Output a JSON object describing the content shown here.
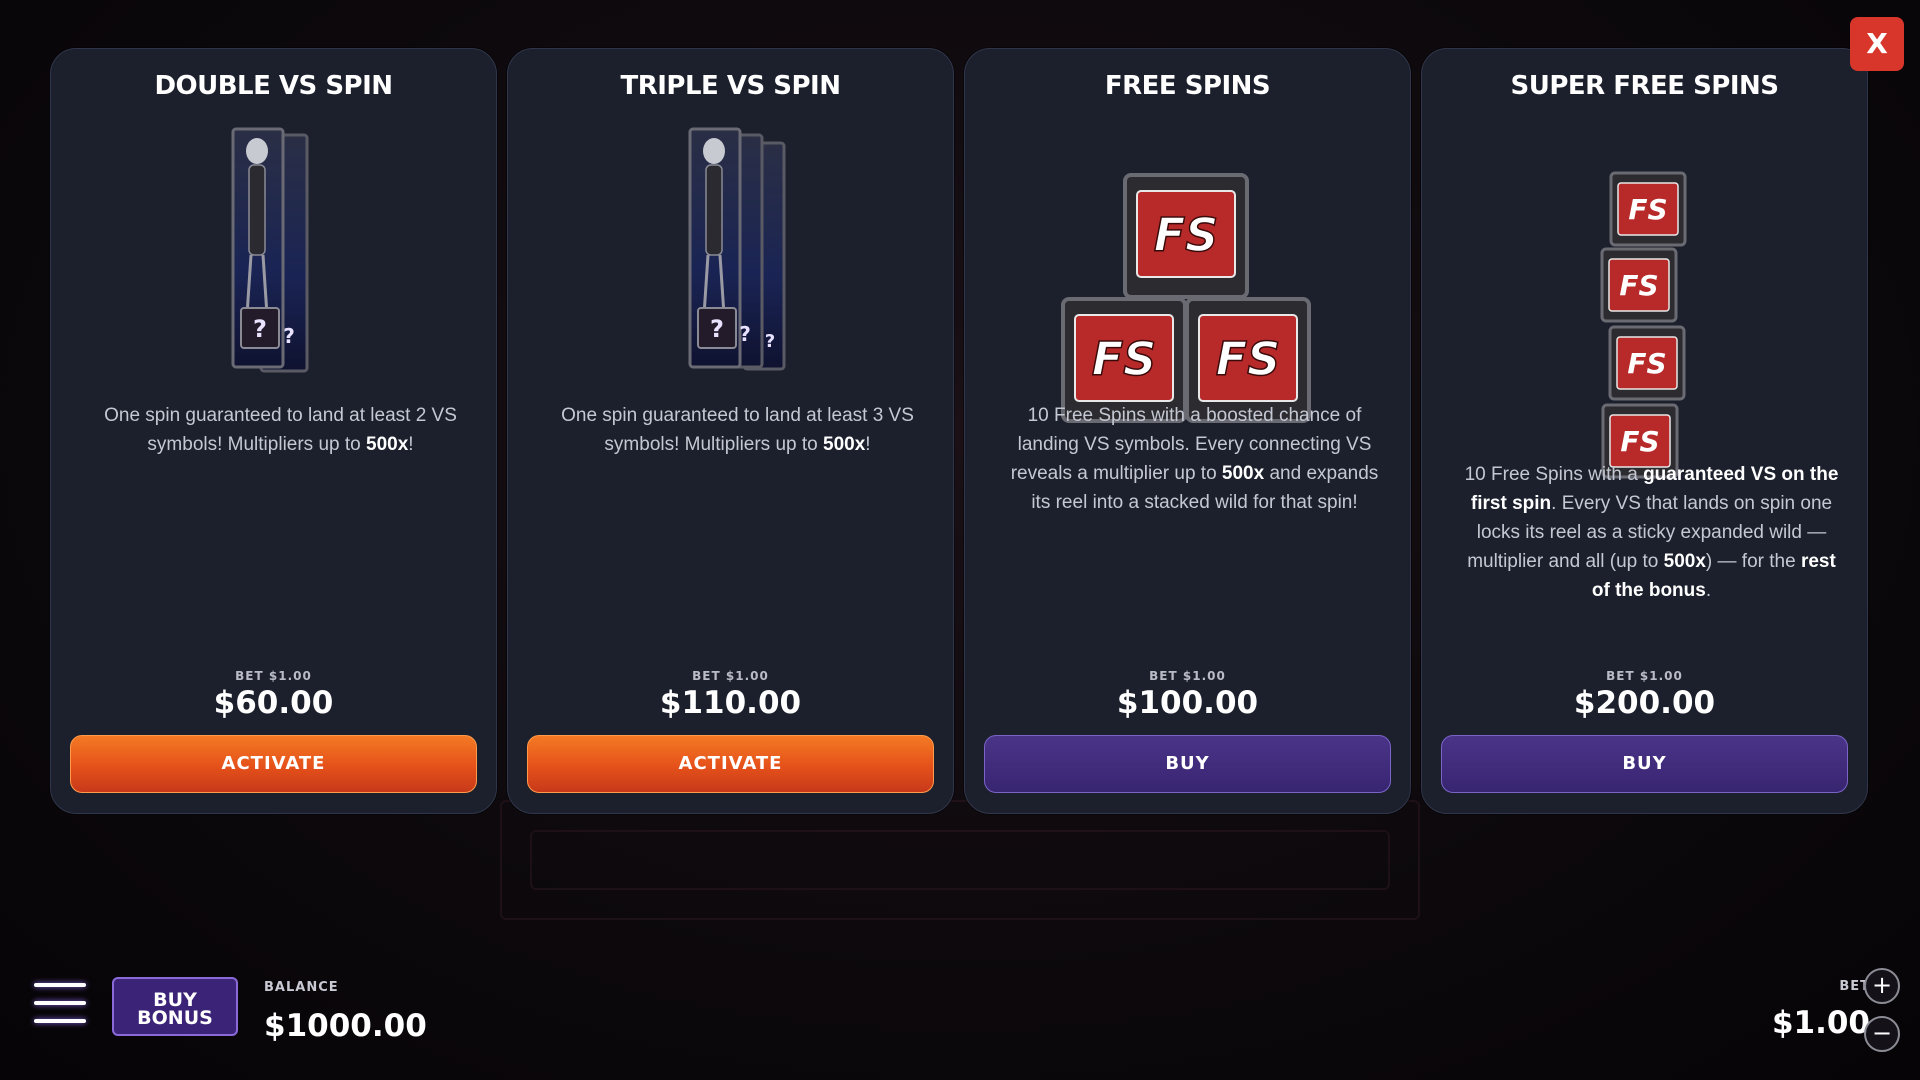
{
  "close_label": "X",
  "cards": [
    {
      "title": "DOUBLE VS SPIN",
      "desc_1": "One spin guaranteed to land at least 2 VS symbols! Multipliers up to ",
      "desc_2": "500x",
      "desc_3": "!",
      "bet_label": "BET $1.00",
      "price": "$60.00",
      "button": "ACTIVATE",
      "art_mark": "?"
    },
    {
      "title": "TRIPLE VS SPIN",
      "desc_1": "One spin guaranteed to land at least 3 VS symbols! Multipliers up to ",
      "desc_2": "500x",
      "desc_3": "!",
      "bet_label": "BET $1.00",
      "price": "$110.00",
      "button": "ACTIVATE",
      "art_mark": "?"
    },
    {
      "title": "FREE SPINS",
      "desc_1": "10 Free Spins with a boosted chance of landing VS symbols. Every connecting VS reveals a multiplier up to ",
      "desc_2": "500x",
      "desc_3": " and expands its reel into a stacked wild for that spin!",
      "bet_label": "BET $1.00",
      "price": "$100.00",
      "button": "BUY",
      "art_mark": "FS"
    },
    {
      "title": "SUPER FREE SPINS",
      "desc_1": "10 Free Spins with a ",
      "desc_2": "guaranteed VS on the first spin",
      "desc_3": ". Every VS that lands on spin one locks its reel as a sticky expanded wild — multiplier and all (up to ",
      "desc_4": "500x",
      "desc_5": ") — for the ",
      "desc_6": "rest of the bonus",
      "desc_7": ".",
      "bet_label": "BET $1.00",
      "price": "$200.00",
      "button": "BUY",
      "art_mark": "FS"
    }
  ],
  "bottom_bar": {
    "buy_bonus_line1": "BUY",
    "buy_bonus_line2": "BONUS",
    "balance_label": "BALANCE",
    "balance_value": "$1000.00",
    "bet_label": "BET",
    "bet_value": "$1.00",
    "plus": "+",
    "minus": "−"
  },
  "colors": {
    "activate": "#e5511a",
    "buy": "#382571",
    "close": "#d8352b",
    "card_bg": "#1c202c"
  },
  "icons": [
    "menu-icon",
    "plus-icon",
    "minus-icon",
    "close-icon",
    "skeleton-reel-icon",
    "free-spins-scatter-icon"
  ]
}
